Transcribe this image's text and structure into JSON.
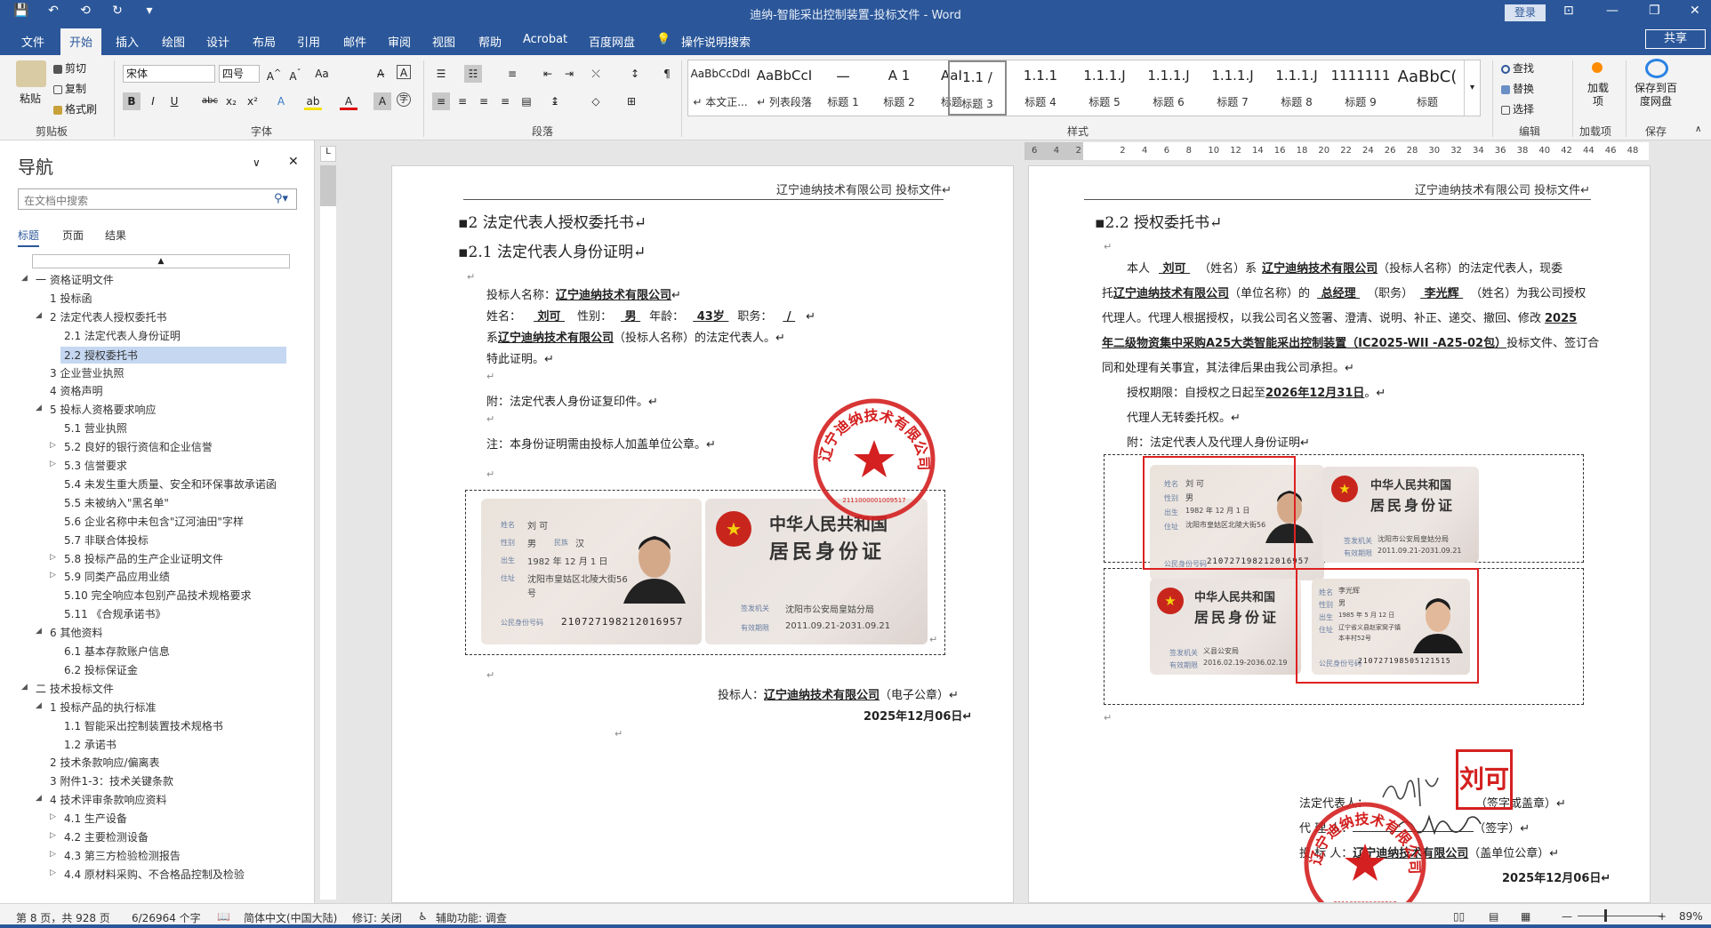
{
  "window": {
    "title": "迪纳-智能采出控制装置-投标文件  -  Word",
    "login_label": "登录",
    "controls": [
      "⊡",
      "—",
      "❐",
      "✕"
    ]
  },
  "qat": [
    "💾",
    "↶",
    "⟲",
    "↻",
    "▾"
  ],
  "ribbon": {
    "tabs": [
      "文件",
      "开始",
      "插入",
      "绘图",
      "设计",
      "布局",
      "引用",
      "邮件",
      "审阅",
      "视图",
      "帮助",
      "Acrobat",
      "百度网盘"
    ],
    "active_tab": "开始",
    "tell_me": "操作说明搜索",
    "share": "共享",
    "clipboard": {
      "paste": "粘贴",
      "cut": "剪切",
      "copy": "复制",
      "format_painter": "格式刷",
      "label": "剪贴板"
    },
    "font": {
      "name": "宋体",
      "size": "四号",
      "label": "字体"
    },
    "paragraph_label": "段落",
    "styles": [
      {
        "preview": "AaBbCcDdI",
        "name": "↵ 本文正..."
      },
      {
        "preview": "AaBbCcI",
        "name": "↵ 列表段落"
      },
      {
        "preview": "一",
        "name": "标题 1"
      },
      {
        "preview": "A 1",
        "name": "标题 2"
      },
      {
        "preview": "AaI",
        "name": "标题"
      },
      {
        "preview": "1.1 /",
        "name": "标题 3"
      },
      {
        "preview": "1.1.1",
        "name": "标题 4"
      },
      {
        "preview": "1.1.1.J",
        "name": "标题 5"
      },
      {
        "preview": "1.1.1.J",
        "name": "标题 6"
      },
      {
        "preview": "1.1.1.J",
        "name": "标题 7"
      },
      {
        "preview": "1.1.1.J",
        "name": "标题 8"
      },
      {
        "preview": "1111111",
        "name": "标题 9"
      },
      {
        "preview": "AaBbC(",
        "name": "标题"
      }
    ],
    "styles_label": "样式",
    "editing": {
      "find": "查找",
      "replace": "替换",
      "select": "选择",
      "label": "编辑"
    },
    "addins": {
      "btn": "加载项",
      "label": "加载项"
    },
    "baidu": {
      "btn": "保存到百度网盘",
      "label": "保存"
    }
  },
  "nav": {
    "title": "导航",
    "search_placeholder": "在文档中搜索",
    "tabs": [
      "标题",
      "页面",
      "结果"
    ],
    "items": [
      {
        "text": "一 资格证明文件",
        "lvl": 1,
        "tri": "◢"
      },
      {
        "text": "1 投标函",
        "lvl": 2,
        "tri": ""
      },
      {
        "text": "2 法定代表人授权委托书",
        "lvl": 2,
        "tri": "◢"
      },
      {
        "text": "2.1 法定代表人身份证明",
        "lvl": 3,
        "tri": ""
      },
      {
        "text": "2.2 授权委托书",
        "lvl": 3,
        "tri": "",
        "sel": true
      },
      {
        "text": "3 企业营业执照",
        "lvl": 2,
        "tri": ""
      },
      {
        "text": "4 资格声明",
        "lvl": 2,
        "tri": ""
      },
      {
        "text": "5 投标人资格要求响应",
        "lvl": 2,
        "tri": "◢"
      },
      {
        "text": "5.1 营业执照",
        "lvl": 3,
        "tri": ""
      },
      {
        "text": "5.2 良好的银行资信和企业信誉",
        "lvl": 3,
        "tri": "▷"
      },
      {
        "text": "5.3 信誉要求",
        "lvl": 3,
        "tri": "▷"
      },
      {
        "text": "5.4 未发生重大质量、安全和环保事故承诺函",
        "lvl": 3,
        "tri": ""
      },
      {
        "text": "5.5 未被纳入\"黑名单\"",
        "lvl": 3,
        "tri": ""
      },
      {
        "text": "5.6 企业名称中未包含\"辽河油田\"字样",
        "lvl": 3,
        "tri": ""
      },
      {
        "text": "5.7 非联合体投标",
        "lvl": 3,
        "tri": ""
      },
      {
        "text": "5.8 投标产品的生产企业证明文件",
        "lvl": 3,
        "tri": "▷"
      },
      {
        "text": "5.9 同类产品应用业绩",
        "lvl": 3,
        "tri": "▷"
      },
      {
        "text": "5.10 完全响应本包别产品技术规格要求",
        "lvl": 3,
        "tri": ""
      },
      {
        "text": "5.11 《合规承诺书》",
        "lvl": 3,
        "tri": ""
      },
      {
        "text": "6 其他资料",
        "lvl": 2,
        "tri": "◢"
      },
      {
        "text": "6.1 基本存款账户信息",
        "lvl": 3,
        "tri": ""
      },
      {
        "text": "6.2 投标保证金",
        "lvl": 3,
        "tri": ""
      },
      {
        "text": "二 技术投标文件",
        "lvl": 1,
        "tri": "◢"
      },
      {
        "text": "1 投标产品的执行标准",
        "lvl": 2,
        "tri": "◢"
      },
      {
        "text": "1.1 智能采出控制装置技术规格书",
        "lvl": 3,
        "tri": ""
      },
      {
        "text": "1.2 承诺书",
        "lvl": 3,
        "tri": ""
      },
      {
        "text": "2 技术条款响应/偏离表",
        "lvl": 2,
        "tri": ""
      },
      {
        "text": "3 附件1-3：技术关键条款",
        "lvl": 2,
        "tri": ""
      },
      {
        "text": "4 技术评审条款响应资料",
        "lvl": 2,
        "tri": "◢"
      },
      {
        "text": "4.1 生产设备",
        "lvl": 3,
        "tri": "▷"
      },
      {
        "text": "4.2 主要检测设备",
        "lvl": 3,
        "tri": "▷"
      },
      {
        "text": "4.3 第三方检验检测报告",
        "lvl": 3,
        "tri": "▷"
      },
      {
        "text": "4.4 原材料采购、不合格品控制及检验",
        "lvl": 3,
        "tri": "▷"
      }
    ]
  },
  "ruler": {
    "numbers": [
      "6",
      "4",
      "2",
      "",
      "2",
      "4",
      "6",
      "8",
      "10",
      "12",
      "14",
      "16",
      "18",
      "20",
      "22",
      "24",
      "26",
      "28",
      "30",
      "32",
      "34",
      "36",
      "38",
      "40",
      "42",
      "44",
      "46",
      "48"
    ]
  },
  "page1": {
    "header": "辽宁迪纳技术有限公司    投标文件↵",
    "h_2": "2 法定代表人授权委托书↵",
    "h_21": "2.1 法定代表人身份证明↵",
    "l1_pre": "投标人名称：",
    "l1_company": "辽宁迪纳技术有限公司",
    "l2_name_pre": "姓名：",
    "l2_name": "  刘可  ",
    "l2_sex_pre": "性别：",
    "l2_sex": "  男  ",
    "l2_age_pre": "年龄：",
    "l2_age": "  43岁  ",
    "l2_pos_pre": "职务：",
    "l2_pos": "  /  ",
    "l3_pre": "系",
    "l3_company": "辽宁迪纳技术有限公司",
    "l3_post": "（投标人名称）的法定代表人。↵",
    "l4": "特此证明。↵",
    "l5": "附：法定代表人身份证复印件。↵",
    "l6": "注：本身份证明需由投标人加盖单位公章。↵",
    "sign_pre": "投标人：",
    "sign_company": "辽宁迪纳技术有限公司",
    "sign_post": "（电子公章）↵",
    "date": "2025年12月06日↵"
  },
  "page2": {
    "header": "辽宁迪纳技术有限公司    投标文件↵",
    "h_22": "2.2 授权委托书↵",
    "p1a": "本人",
    "p1_name": "  刘可  ",
    "p1b": "（姓名）系",
    "p1_company": "辽宁迪纳技术有限公司",
    "p1c": "（投标人名称）的法定代表人，现委",
    "p2a": "托",
    "p2_company": "辽宁迪纳技术有限公司",
    "p2b": "（单位名称）的",
    "p2_pos": "  总经理  ",
    "p2c": "（职务）",
    "p2_name": "  李光辉  ",
    "p2d": "（姓名）为我公司授权",
    "p3a": "代理人。代理人根据授权，以我公司名义签署、澄清、说明、补正、递交、撤回、修改",
    "p3_year": "2025",
    "p4_project": "年二级物资集中采购A25大类智能采出控制装置（IC2025-WII -A25-02包）",
    "p4b": "投标文件、签订合",
    "p5": "同和处理有关事宜，其法律后果由我公司承担。↵",
    "p6a": "授权期限：自授权之日起至",
    "p6_date": "2026年12月31日",
    "p6b": "。↵",
    "p7": "代理人无转委托权。↵",
    "p8": "附：法定代表人及代理人身份证明↵",
    "sig1": "法定代表人：",
    "sig1_post": "（签字或盖章）↵",
    "sig2": "代  理  人：",
    "sig2_post": "（签字）↵",
    "sig3": "投  标  人：",
    "sig3_company": "辽宁迪纳技术有限公司",
    "sig3_post": "（盖单位公章）↵",
    "date": "2025年12月06日↵",
    "name_stamp": "刘可"
  },
  "idcards": {
    "front_title_1": "中华人民共和国",
    "front_title_2": "居民身份证",
    "card1": {
      "name": "刘 可",
      "sex": "男",
      "nation": "汉",
      "birth": "1982  年  12  月  1  日",
      "addr": "沈阳市皇姑区北陵大街56",
      "addr2": "号",
      "num": "210727198212016957",
      "authority": "沈阳市公安局皇姑分局",
      "valid": "2011.09.21-2031.09.21"
    },
    "card2": {
      "name": "李光辉",
      "sex": "男",
      "nation": "汉",
      "birth": "1985  年  5  月  12  日",
      "addr": "辽宁省义县赵家窝子镇",
      "addr2": "本丰村52号",
      "num": "210727198505121515",
      "authority": "义县公安局",
      "valid": "2016.02.19-2036.02.19"
    },
    "labels": {
      "name": "姓名",
      "sex": "性别",
      "nation": "民族",
      "birth": "出生",
      "addr": "住址",
      "num": "公民身份号码",
      "authority": "签发机关",
      "valid": "有效期限"
    }
  },
  "seal": {
    "text": "辽宁迪纳技术有限公司",
    "code": "2111000001009517"
  },
  "status": {
    "page": "第 8 页，共 928 页",
    "words": "6/26964 个字",
    "lang": "简体中文(中国大陆)",
    "track": "修订: 关闭",
    "access": "辅助功能: 调查",
    "zoom": "89%"
  },
  "colors": {
    "word_blue": "#2b579a",
    "seal_red": "#d42020",
    "select": "#c5d7f1"
  }
}
